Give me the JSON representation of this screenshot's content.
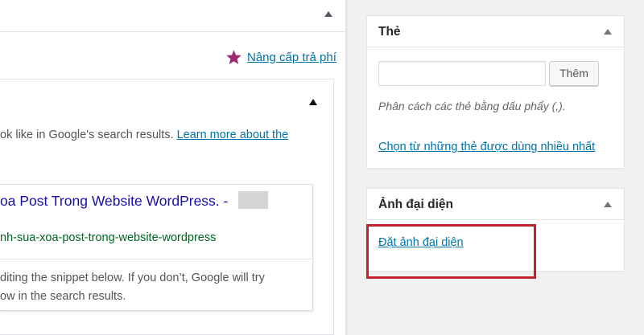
{
  "editor": {
    "upgrade_link": "Nâng cấp trả phí",
    "upgrade_star_color": "#9b2b6e",
    "seo": {
      "intro_text": "ok like in Google's search results. ",
      "learn_more_link": "Learn more about the",
      "snippet_title": "oa Post Trong Website WordPress. -",
      "snippet_url": "nh-sua-xoa-post-trong-website-wordpress",
      "help_line1": "diting the snippet below. If you don’t, Google will try",
      "help_line2": "ow in the search results."
    }
  },
  "sidebar": {
    "tags": {
      "title": "Thẻ",
      "input_value": "",
      "add_button": "Thêm",
      "hint": "Phân cách các thẻ bằng dấu phẩy (,).",
      "choose_link": "Chọn từ những thẻ được dùng nhiều nhất"
    },
    "featured_image": {
      "title": "Ảnh đại diện",
      "set_link": "Đặt ảnh đại diện"
    }
  },
  "colors": {
    "link": "#0073aa",
    "highlight": "#c3222a",
    "serp_title": "#1a0dab",
    "serp_url": "#006621"
  }
}
